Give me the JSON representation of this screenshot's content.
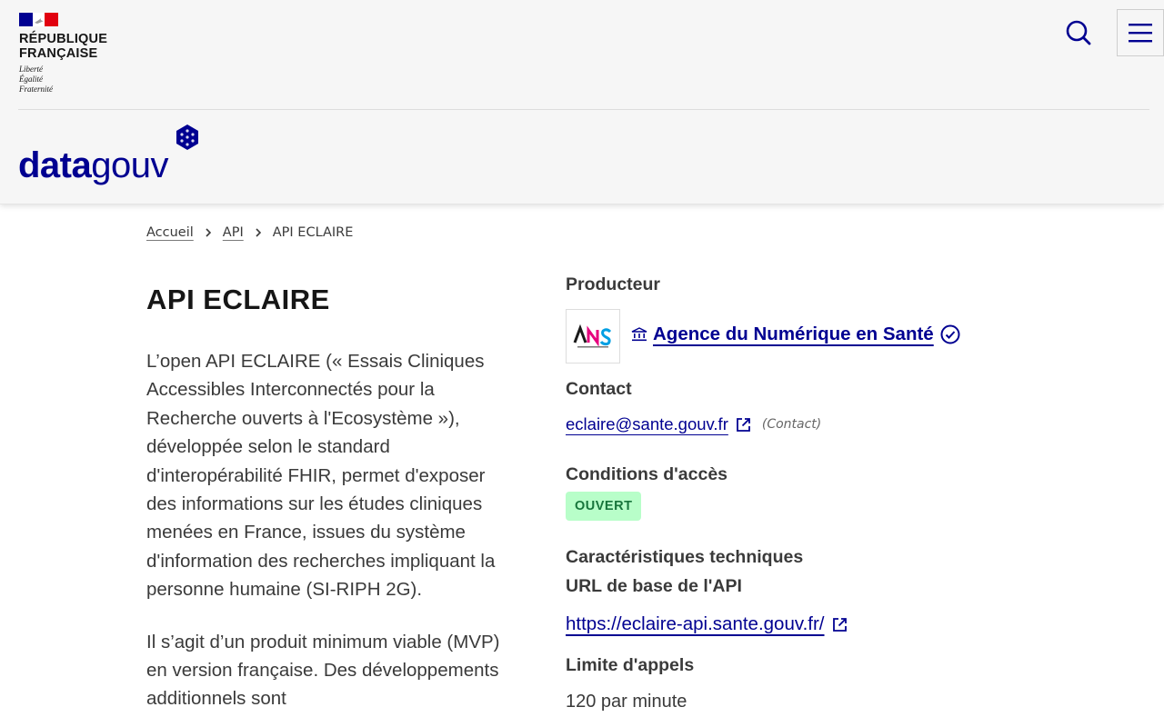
{
  "header": {
    "republic_name_line1": "RÉPUBLIQUE",
    "republic_name_line2": "FRANÇAISE",
    "motto_line1": "Liberté",
    "motto_line2": "Égalité",
    "motto_line3": "Fraternité",
    "logo_text_bold": "data",
    "logo_text_light": "gouv",
    "search_icon": "search-icon",
    "menu_icon": "menu-icon",
    "brand_color": "#000091"
  },
  "breadcrumb": {
    "items": [
      "Accueil",
      "API"
    ],
    "current": "API ECLAIRE"
  },
  "main": {
    "title": "API ECLAIRE",
    "description_p1": "L’open API ECLAIRE (« Essais Cliniques Accessibles Interconnectés pour la Recherche ouverts à l'Ecosystème »), développée selon le standard d'interopérabilité FHIR, permet d'exposer des informations sur les études cliniques menées en France, issues du système d'information des recherches impliquant la personne humaine (SI-RIPH 2G).",
    "description_p2": "Il s’agit d’un produit minimum viable (MVP) en version française. Des développements additionnels sont"
  },
  "sidebar": {
    "producer_heading": "Producteur",
    "producer_name": "Agence du Numérique en Santé",
    "producer_logo_text": "ANS",
    "contact_heading": "Contact",
    "contact_email": "eclaire@sante.gouv.fr",
    "contact_note": "(Contact)",
    "access_heading": "Conditions d'accès",
    "access_badge": "OUVERT",
    "tech_heading": "Caractéristiques techniques",
    "base_url_heading": "URL de base de l'API",
    "base_url": "https://eclaire-api.sante.gouv.fr/",
    "rate_limit_heading": "Limite d'appels",
    "rate_limit_value": "120 par minute",
    "badge_color": "#b8fec9",
    "badge_text_color": "#18753c"
  }
}
